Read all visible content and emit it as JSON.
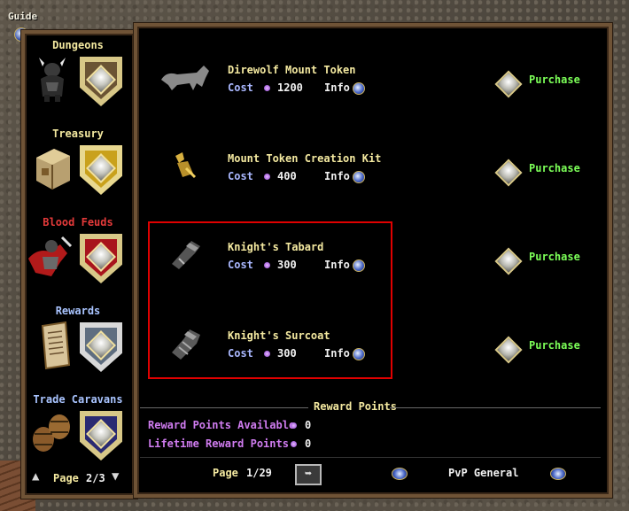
{
  "guide": {
    "label": "Guide"
  },
  "sidebar": {
    "categories": [
      {
        "label": "Dungeons",
        "color": "#f4e9a0",
        "shield_color": "#6b5434"
      },
      {
        "label": "Treasury",
        "color": "#f4e9a0",
        "shield_color": "#c9a11c"
      },
      {
        "label": "Blood Feuds",
        "color": "#e43a3a",
        "shield_color": "#a8141c"
      },
      {
        "label": "Rewards",
        "color": "#a9c4ff",
        "shield_color": "#5f6e80"
      },
      {
        "label": "Trade Caravans",
        "color": "#a9c4ff",
        "shield_color": "#2a2a72"
      }
    ],
    "page_label": "Page",
    "page_value": "2/3"
  },
  "items": [
    {
      "name": "Direwolf Mount Token",
      "cost_label": "Cost",
      "cost": "1200",
      "info_label": "Info",
      "purchase_label": "Purchase",
      "icon": "direwolf-icon"
    },
    {
      "name": "Mount Token Creation Kit",
      "cost_label": "Cost",
      "cost": "400",
      "info_label": "Info",
      "purchase_label": "Purchase",
      "icon": "creation-kit-icon"
    },
    {
      "name": "Knight's Tabard",
      "cost_label": "Cost",
      "cost": "300",
      "info_label": "Info",
      "purchase_label": "Purchase",
      "icon": "tabard-icon"
    },
    {
      "name": "Knight's Surcoat",
      "cost_label": "Cost",
      "cost": "300",
      "info_label": "Info",
      "purchase_label": "Purchase",
      "icon": "surcoat-icon"
    }
  ],
  "reward_points": {
    "title": "Reward Points",
    "available_label": "Reward Points Available",
    "available_value": "0",
    "lifetime_label": "Lifetime Reward Points",
    "lifetime_value": "0"
  },
  "footer": {
    "page_label": "Page",
    "page_value": "1/29",
    "category": "PvP General"
  },
  "colors": {
    "accent_text": "#f4e9a0",
    "purchase": "#7cff58",
    "reward_label": "#d07cf0",
    "highlight_border": "#e00000"
  }
}
